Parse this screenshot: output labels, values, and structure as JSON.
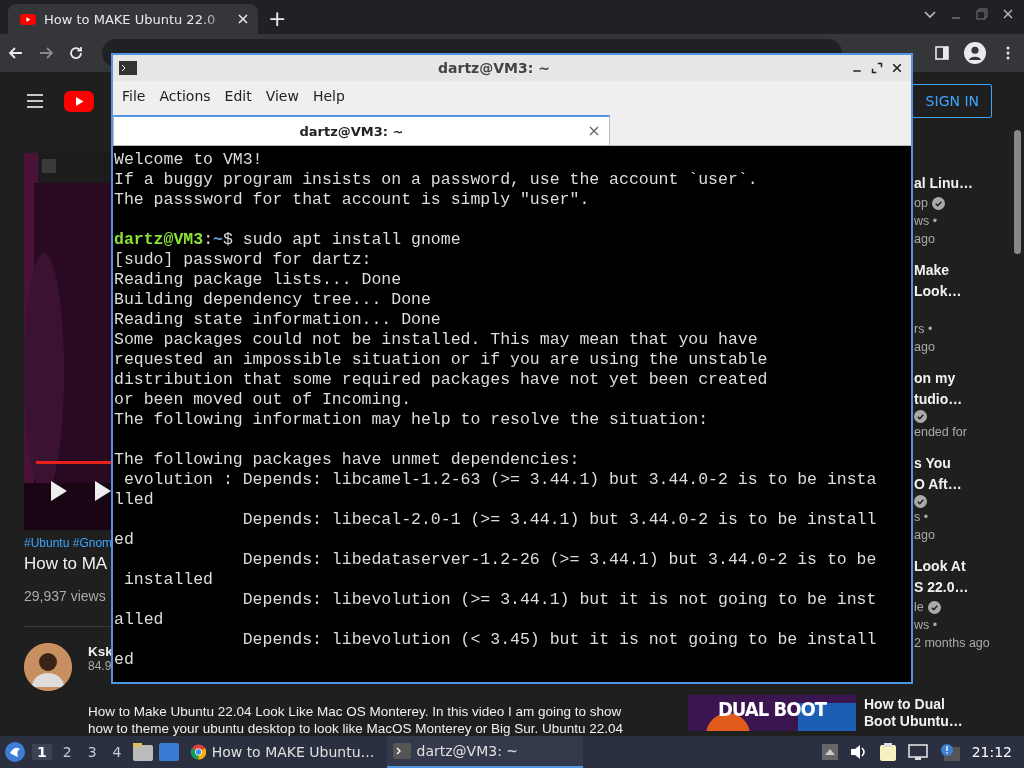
{
  "browser": {
    "tabs": [
      {
        "title": "How to MAKE Ubuntu 22.0",
        "selected": true
      }
    ],
    "new_tab": "+"
  },
  "youtube": {
    "sign_in": "SIGN IN",
    "video": {
      "kind": "picture",
      "progress": {
        "level": 1
      }
    },
    "hashtags": "#Ubuntu #Gnom",
    "title": "How to MA",
    "views": "29,937 views",
    "channel": {
      "name": "Ksk",
      "subscribers": "84.9"
    },
    "description": [
      "How to Make Ubuntu 22.04 Look Like Mac OS Monterey. In this video I am going to show",
      "how to theme your ubuntu desktop to look like MacOS Monterey or Big Sur. Ubuntu 22.04"
    ],
    "related": [
      {
        "lines": [
          {
            "kind": "title",
            "text": "al Linu…"
          },
          {
            "kind": "channel",
            "text": "op",
            "verified": true
          },
          {
            "kind": "meta",
            "text": "ws •"
          },
          {
            "kind": "meta",
            "text": "ago"
          }
        ]
      },
      {
        "lines": [
          {
            "kind": "title",
            "text": "Make"
          },
          {
            "kind": "title",
            "text": "Look…"
          },
          {
            "kind": "gap"
          },
          {
            "kind": "meta",
            "text": "rs •"
          },
          {
            "kind": "meta",
            "text": "ago"
          }
        ]
      },
      {
        "lines": [
          {
            "kind": "title",
            "text": "on my"
          },
          {
            "kind": "title",
            "text": "tudio…"
          },
          {
            "kind": "channel",
            "verified": true
          },
          {
            "kind": "meta",
            "text": "ended for"
          }
        ]
      },
      {
        "lines": [
          {
            "kind": "title",
            "text": "s You"
          },
          {
            "kind": "title",
            "text": "O Aft…"
          },
          {
            "kind": "channel",
            "verified": true
          },
          {
            "kind": "meta",
            "text": "s •"
          },
          {
            "kind": "meta",
            "text": "ago"
          }
        ]
      },
      {
        "lines": [
          {
            "kind": "title",
            "text": "Look At"
          },
          {
            "kind": "title",
            "text": "S 22.0…"
          },
          {
            "kind": "channel",
            "text": "le",
            "verified": true
          },
          {
            "kind": "meta",
            "text": "ws •"
          },
          {
            "kind": "age",
            "text": "2 months ago"
          }
        ]
      }
    ],
    "featured": {
      "thumbnail_text": "DUAL BOOT",
      "title": [
        "How to Dual",
        "Boot Ubuntu…"
      ]
    }
  },
  "terminal": {
    "title": "dartz@VM3: ~",
    "menu": [
      "File",
      "Actions",
      "Edit",
      "View",
      "Help"
    ],
    "tabs": [
      {
        "title": "dartz@VM3: ~",
        "selected": true
      }
    ],
    "blocks": [
      {
        "lines": [
          {
            "text": "Welcome to VM3!"
          },
          {
            "text": "If a buggy program insists on a password, use the account `user`."
          },
          {
            "text": "The passsword for that account is simply \"user\"."
          }
        ]
      },
      {
        "lines": [
          {
            "kind": "prompt",
            "user": "dartz@VM3",
            "sep": ":",
            "path": "~",
            "command": "$ sudo apt install gnome"
          },
          {
            "text": "[sudo] password for dartz:"
          },
          {
            "text": "Reading package lists... Done"
          },
          {
            "text": "Building dependency tree... Done"
          },
          {
            "text": "Reading state information... Done"
          },
          {
            "text": "Some packages could not be installed. This may mean that you have"
          },
          {
            "text": "requested an impossible situation or if you are using the unstable"
          },
          {
            "text": "distribution that some required packages have not yet been created"
          },
          {
            "text": "or been moved out of Incoming."
          },
          {
            "text": "The following information may help to resolve the situation:"
          }
        ]
      },
      {
        "lines": [
          {
            "text": "The following packages have unmet dependencies:"
          },
          {
            "text": " evolution : Depends: libcamel-1.2-63 (>= 3.44.1) but 3.44.0-2 is to be insta"
          },
          {
            "text": "lled"
          },
          {
            "text": "             Depends: libecal-2.0-1 (>= 3.44.1) but 3.44.0-2 is to be install"
          },
          {
            "text": "ed"
          },
          {
            "text": "             Depends: libedataserver-1.2-26 (>= 3.44.1) but 3.44.0-2 is to be"
          },
          {
            "text": " installed"
          },
          {
            "text": "             Depends: libevolution (>= 3.44.1) but it is not going to be inst"
          },
          {
            "text": "alled"
          },
          {
            "text": "             Depends: libevolution (< 3.45) but it is not going to be install"
          },
          {
            "text": "ed"
          }
        ]
      }
    ]
  },
  "taskbar": {
    "workspaces": [
      {
        "label": "1",
        "selected": true
      },
      {
        "label": "2",
        "selected": false
      },
      {
        "label": "3",
        "selected": false
      },
      {
        "label": "4",
        "selected": false
      }
    ],
    "windows": [
      {
        "kind": "browser",
        "title": "How to MAKE Ubuntu…",
        "selected": false
      },
      {
        "kind": "terminal",
        "title": "dartz@VM3: ~",
        "selected": true
      }
    ],
    "clock": "21:12"
  }
}
